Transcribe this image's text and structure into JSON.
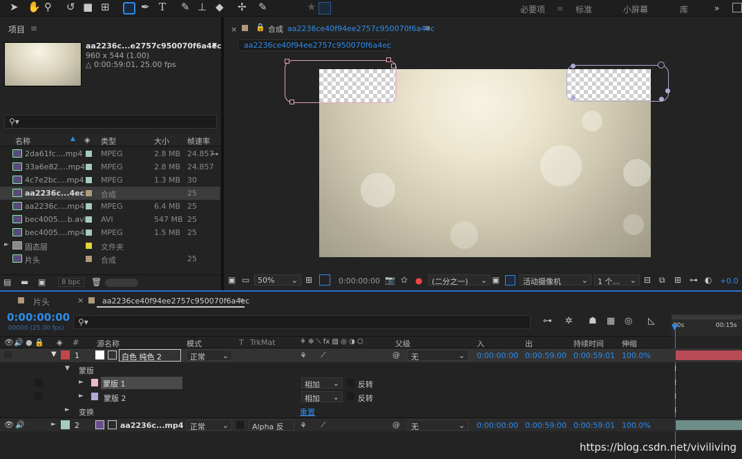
{
  "toolbar": {
    "tools": [
      "selection-icon",
      "hand-icon",
      "zoom-icon",
      "rotate-icon",
      "camera-icon",
      "pan-behind-icon",
      "rectangle-icon",
      "pen-icon",
      "text-icon",
      "brush-icon",
      "clone-stamp-icon",
      "eraser-icon",
      "roto-brush-icon",
      "puppet-pin-icon",
      "star-icon",
      "snapping-icon"
    ],
    "workspaces": [
      "必要项",
      "标准",
      "小屏幕",
      "库"
    ],
    "more": "»"
  },
  "project": {
    "title": "项目",
    "menu": "≡",
    "selected_name": "aa2236c...e2757c950070f6a4ec",
    "selected_info1": "960 x 544 (1.00)",
    "selected_info2": "△ 0:00:59:01, 25.00 fps",
    "search_placeholder": "",
    "columns": [
      "名称",
      "类型",
      "大小",
      "帧速率"
    ],
    "rows": [
      {
        "name": "2da61fc....mp4",
        "color": "#a7cbc2",
        "type": "MPEG",
        "size": "2.8 MB",
        "fps": "24.857"
      },
      {
        "name": "33a6e82....mp4",
        "color": "#a7cbc2",
        "type": "MPEG",
        "size": "2.8 MB",
        "fps": "24.857"
      },
      {
        "name": "4c7e2bc....mp4",
        "color": "#a7cbc2",
        "type": "MPEG",
        "size": "1.3 MB",
        "fps": "30"
      },
      {
        "name": "aa2236c...4ec",
        "color": "#b09a7a",
        "type": "合成",
        "size": "",
        "fps": "25"
      },
      {
        "name": "aa2236c....mp4",
        "color": "#a7cbc2",
        "type": "MPEG",
        "size": "6.4 MB",
        "fps": "25"
      },
      {
        "name": "bec4005....b.avi",
        "color": "#a7cbc2",
        "type": "AVI",
        "size": "547 MB",
        "fps": "25"
      },
      {
        "name": "bec4005....mp4",
        "color": "#a7cbc2",
        "type": "MPEG",
        "size": "1.5 MB",
        "fps": "25"
      },
      {
        "name": "固态层",
        "color": "#e1d53a",
        "type": "文件夹",
        "size": "",
        "fps": ""
      },
      {
        "name": "片头",
        "color": "#b09a7a",
        "type": "合成",
        "size": "",
        "fps": "25"
      }
    ],
    "bpc": "8 bpc"
  },
  "viewer": {
    "tab_prefix": "合成",
    "comp_name": "aa2236ce40f94ee2757c950070f6a4ec",
    "breadcrumb": "aa2236ce40f94ee2757c950070f6a4ec",
    "zoom": "50%",
    "timecode": "0:00:00:00",
    "resolution": "(二分之一)",
    "camera": "活动摄像机",
    "views": "1 个...",
    "exposure": "+0.0"
  },
  "timeline": {
    "tabs": [
      "片头",
      "aa2236ce40f94ee2757c950070f6a4ec"
    ],
    "timecode": "0:00:00:00",
    "frame_info": "00000 (25.00 fps)",
    "search_placeholder": "",
    "columns": {
      "src": "源名称",
      "mode": "模式",
      "t": "T",
      "trkmat": "TrkMat",
      "parent": "父级",
      "in": "入",
      "out": "出",
      "duration": "持续时间",
      "stretch": "伸缩"
    },
    "ruler": [
      "00s",
      "00:15s"
    ],
    "layer1": {
      "num": "1",
      "name": "白色 纯色 2",
      "mode": "正常",
      "parent": "无",
      "in": "0:00:00:00",
      "out": "0:00:59:00",
      "duration": "0:00:59:01",
      "stretch": "100.0%",
      "label_color": "#c04848"
    },
    "masks_group": "蒙版",
    "mask1": {
      "name": "蒙版 1",
      "mode": "相加",
      "invert": "反转",
      "color": "#e8b8c8"
    },
    "mask2": {
      "name": "蒙版 2",
      "mode": "相加",
      "invert": "反转",
      "color": "#b0aad8"
    },
    "transform": "变换",
    "reset": "重置",
    "layer2": {
      "num": "2",
      "name": "aa2236c...mp4",
      "mode": "正常",
      "trkmat": "Alpha 反",
      "parent": "无",
      "in": "0:00:00:00",
      "out": "0:00:59:00",
      "duration": "0:00:59:01",
      "stretch": "100.0%",
      "label_color": "#a7cbc2"
    }
  },
  "watermark": "https://blog.csdn.net/viviliving"
}
